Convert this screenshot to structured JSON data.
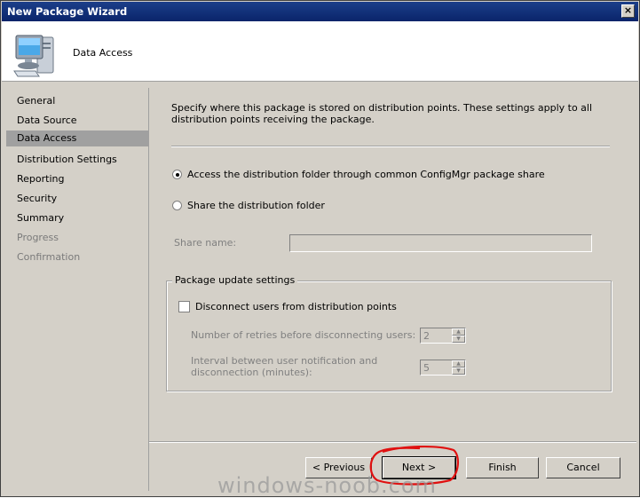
{
  "window": {
    "title": "New Package Wizard",
    "close_label": "×"
  },
  "header": {
    "page_heading": "Data Access"
  },
  "sidebar": {
    "items": [
      {
        "label": "General",
        "state": "normal"
      },
      {
        "label": "Data Source",
        "state": "normal"
      },
      {
        "label": "Data Access",
        "state": "selected"
      },
      {
        "label": "Distribution Settings",
        "state": "normal"
      },
      {
        "label": "Reporting",
        "state": "normal"
      },
      {
        "label": "Security",
        "state": "normal"
      },
      {
        "label": "Summary",
        "state": "normal"
      },
      {
        "label": "Progress",
        "state": "disabled"
      },
      {
        "label": "Confirmation",
        "state": "disabled"
      }
    ]
  },
  "content": {
    "description": "Specify where this package is stored on distribution points. These settings apply to all distribution points receiving the package.",
    "option_common_share": "Access the distribution folder through common ConfigMgr package share",
    "option_share_folder": "Share the distribution folder",
    "share_name_label": "Share name:",
    "share_name_value": "",
    "group_title": "Package update settings",
    "disconnect_label": "Disconnect users from distribution points",
    "retries_label": "Number of retries before disconnecting users:",
    "retries_value": "2",
    "interval_label_line1": "Interval between user notification and",
    "interval_label_line2": "disconnection (minutes):",
    "interval_value": "5"
  },
  "buttons": {
    "previous": "< Previous",
    "next": "Next >",
    "finish": "Finish",
    "cancel": "Cancel"
  },
  "watermark": "windows-noob.com",
  "colors": {
    "titlebar": "#0a246a",
    "annotation": "#e01010",
    "selected_item": "#a0a0a0"
  }
}
